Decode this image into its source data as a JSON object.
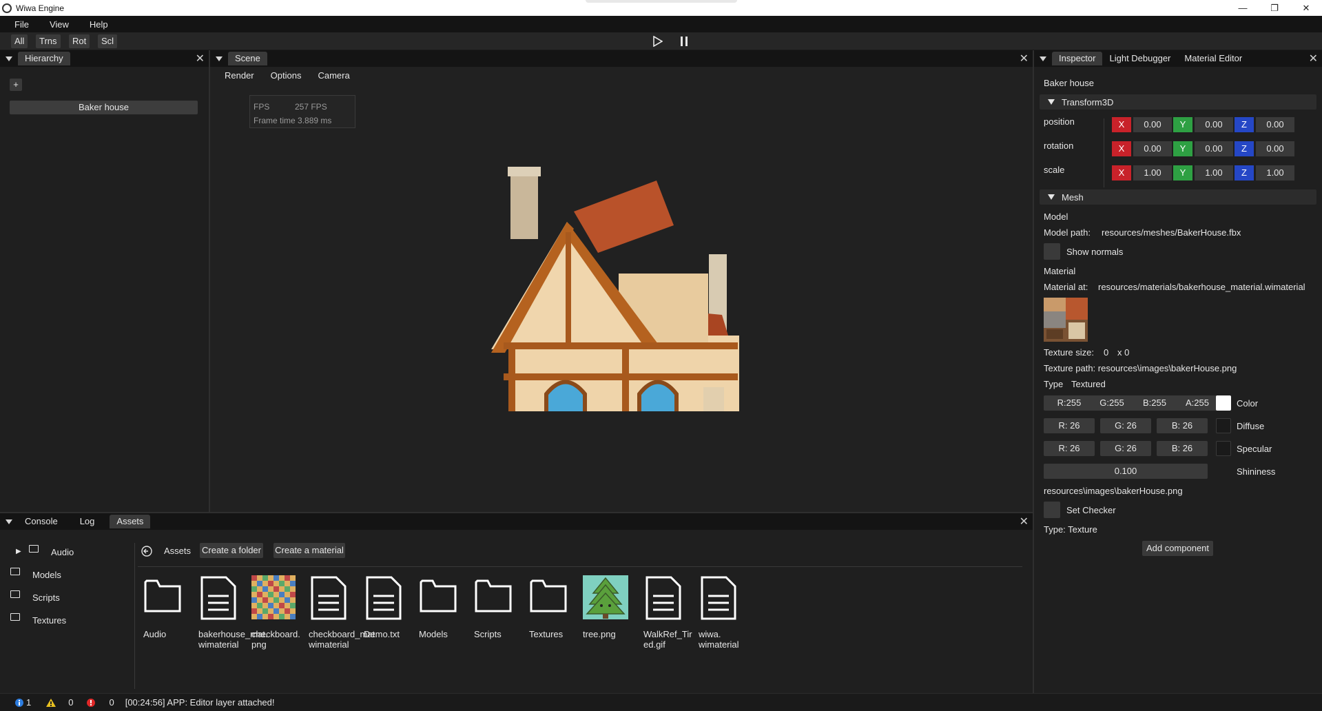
{
  "window": {
    "title": "Wiwa Engine"
  },
  "menu": {
    "file": "File",
    "view": "View",
    "help": "Help"
  },
  "toolbar": {
    "all": "All",
    "trns": "Trns",
    "rot": "Rot",
    "scl": "Scl"
  },
  "hierarchy": {
    "tab": "Hierarchy",
    "add": "+",
    "items": [
      "Baker house"
    ]
  },
  "scene": {
    "tab": "Scene",
    "menu": [
      "Render",
      "Options",
      "Camera"
    ],
    "stats": {
      "fps_label": "FPS",
      "fps_value": "257 FPS",
      "frame_label": "Frame time",
      "frame_value": "3.889 ms"
    }
  },
  "inspector": {
    "tabs": [
      "Inspector",
      "Light Debugger",
      "Material Editor"
    ],
    "object_name": "Baker house",
    "transform": {
      "header": "Transform3D",
      "position_label": "position",
      "rotation_label": "rotation",
      "scale_label": "scale",
      "x": "X",
      "y": "Y",
      "z": "Z",
      "position": [
        "0.00",
        "0.00",
        "0.00"
      ],
      "rotation": [
        "0.00",
        "0.00",
        "0.00"
      ],
      "scale": [
        "1.00",
        "1.00",
        "1.00"
      ]
    },
    "mesh": {
      "header": "Mesh",
      "model_label": "Model",
      "model_path_label": "Model path:",
      "model_path": "resources/meshes/BakerHouse.fbx",
      "show_normals": "Show normals",
      "material_label": "Material",
      "material_at_label": "Material at:",
      "material_at": "resources/materials/bakerhouse_material.wimaterial",
      "texture_size_label": "Texture size:",
      "texture_size_w": "0",
      "texture_size_h": "x 0",
      "texture_path": "Texture path: resources\\images\\bakerHouse.png",
      "type_label": "Type",
      "type_value": "Textured",
      "color": {
        "r": "R:255",
        "g": "G:255",
        "b": "B:255",
        "a": "A:255",
        "label": "Color",
        "swatch": "#ffffff"
      },
      "diffuse": {
        "r": "R: 26",
        "g": "G: 26",
        "b": "B: 26",
        "label": "Diffuse",
        "swatch": "#1a1a1a"
      },
      "specular": {
        "r": "R: 26",
        "g": "G: 26",
        "b": "B: 26",
        "label": "Specular",
        "swatch": "#1a1a1a"
      },
      "shininess_value": "0.100",
      "shininess_label": "Shininess",
      "texture_file": "resources\\images\\bakerHouse.png",
      "set_checker": "Set Checker",
      "type_texture": "Type: Texture"
    },
    "add_component": "Add component"
  },
  "bottom": {
    "tabs": [
      "Console",
      "Log",
      "Assets"
    ],
    "tree": [
      "Audio",
      "Models",
      "Scripts",
      "Textures"
    ],
    "breadcrumb": "Assets",
    "create_folder": "Create a folder",
    "create_material": "Create a material",
    "assets": [
      {
        "name": "Audio",
        "kind": "folder"
      },
      {
        "name": "bakerhouse_mat. wimaterial",
        "kind": "file"
      },
      {
        "name": "checkboard. png",
        "kind": "checker"
      },
      {
        "name": "checkboard_mat. wimaterial",
        "kind": "file"
      },
      {
        "name": "Demo.txt",
        "kind": "file"
      },
      {
        "name": "Models",
        "kind": "folder"
      },
      {
        "name": "Scripts",
        "kind": "folder"
      },
      {
        "name": "Textures",
        "kind": "folder"
      },
      {
        "name": "tree.png",
        "kind": "tree"
      },
      {
        "name": "WalkRef_Tir ed.gif",
        "kind": "file"
      },
      {
        "name": "wiwa. wimaterial",
        "kind": "file"
      }
    ]
  },
  "status": {
    "info_count": "1",
    "warn_count": "0",
    "error_count": "0",
    "message": "[00:24:56] APP: Editor layer attached!"
  },
  "colors": {
    "x": "#c8222a",
    "y": "#2ea043",
    "z": "#2547c6",
    "panel": "#1f1f1f",
    "header": "#141414"
  }
}
